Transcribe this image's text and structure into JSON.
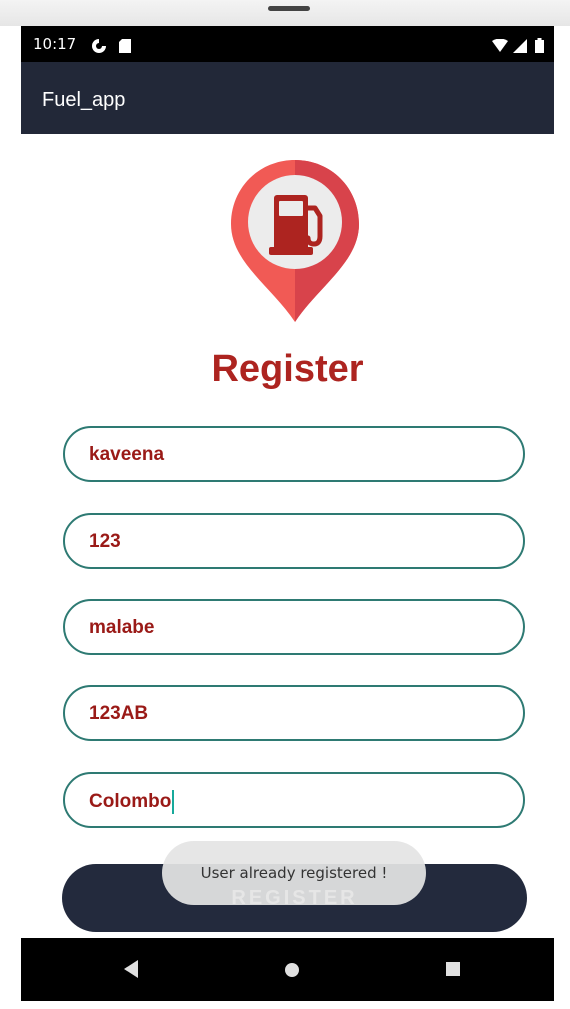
{
  "status_bar": {
    "time": "10:17"
  },
  "app_bar": {
    "title": "Fuel_app"
  },
  "heading": "Register",
  "fields": [
    {
      "value": "kaveena"
    },
    {
      "value": "123"
    },
    {
      "value": "malabe"
    },
    {
      "value": "123AB"
    },
    {
      "value": "Colombo"
    }
  ],
  "register_button": {
    "label": "REGISTER"
  },
  "toast": {
    "message": "User already registered !"
  },
  "colors": {
    "app_bar": "#222838",
    "accent_red": "#ad2420",
    "field_border": "#2e7a73",
    "button": "#232a3d"
  },
  "icons": {
    "status_left": [
      "sync-icon",
      "sd-card-icon"
    ],
    "status_right": [
      "wifi-icon",
      "signal-icon",
      "battery-icon"
    ],
    "logo": "fuel-pump-location-pin-icon",
    "nav": [
      "back-icon",
      "home-icon",
      "recents-icon"
    ]
  }
}
